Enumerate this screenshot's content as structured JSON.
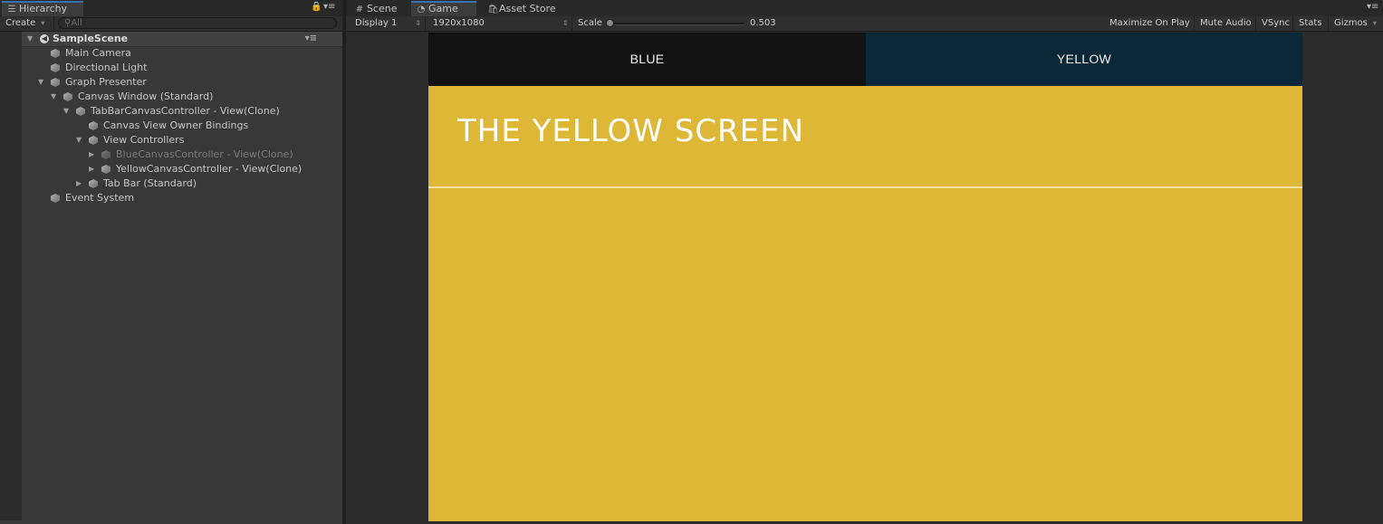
{
  "hierarchy": {
    "tab_label": "Hierarchy",
    "create_label": "Create",
    "search_placeholder": "All",
    "scene_name": "SampleScene",
    "items": [
      {
        "label": "Main Camera",
        "depth": 1,
        "expand": "none",
        "dim": false
      },
      {
        "label": "Directional Light",
        "depth": 1,
        "expand": "none",
        "dim": false
      },
      {
        "label": "Graph Presenter",
        "depth": 1,
        "expand": "open",
        "dim": false
      },
      {
        "label": "Canvas Window (Standard)",
        "depth": 2,
        "expand": "open",
        "dim": false
      },
      {
        "label": "TabBarCanvasController - View(Clone)",
        "depth": 3,
        "expand": "open",
        "dim": false
      },
      {
        "label": "Canvas View Owner Bindings",
        "depth": 4,
        "expand": "none",
        "dim": false
      },
      {
        "label": "View Controllers",
        "depth": 4,
        "expand": "open",
        "dim": false
      },
      {
        "label": "BlueCanvasController - View(Clone)",
        "depth": 5,
        "expand": "closed",
        "dim": true
      },
      {
        "label": "YellowCanvasController - View(Clone)",
        "depth": 5,
        "expand": "closed",
        "dim": false
      },
      {
        "label": "Tab Bar (Standard)",
        "depth": 4,
        "expand": "closed",
        "dim": false
      },
      {
        "label": "Event System",
        "depth": 1,
        "expand": "none",
        "dim": false
      }
    ]
  },
  "view_tabs": {
    "scene": "Scene",
    "game": "Game",
    "asset_store": "Asset Store"
  },
  "game_toolbar": {
    "display": "Display 1",
    "resolution": "1920x1080",
    "scale_label": "Scale",
    "scale_value": "0.503",
    "maximize": "Maximize On Play",
    "mute": "Mute Audio",
    "vsync": "VSync",
    "stats": "Stats",
    "gizmos": "Gizmos"
  },
  "game_view": {
    "tab_blue": "BLUE",
    "tab_yellow": "YELLOW",
    "title": "THE YELLOW SCREEN",
    "colors": {
      "yellow_bg": "#deb736",
      "blue_tab": "#121212",
      "yellow_tab": "#0b2838"
    }
  }
}
